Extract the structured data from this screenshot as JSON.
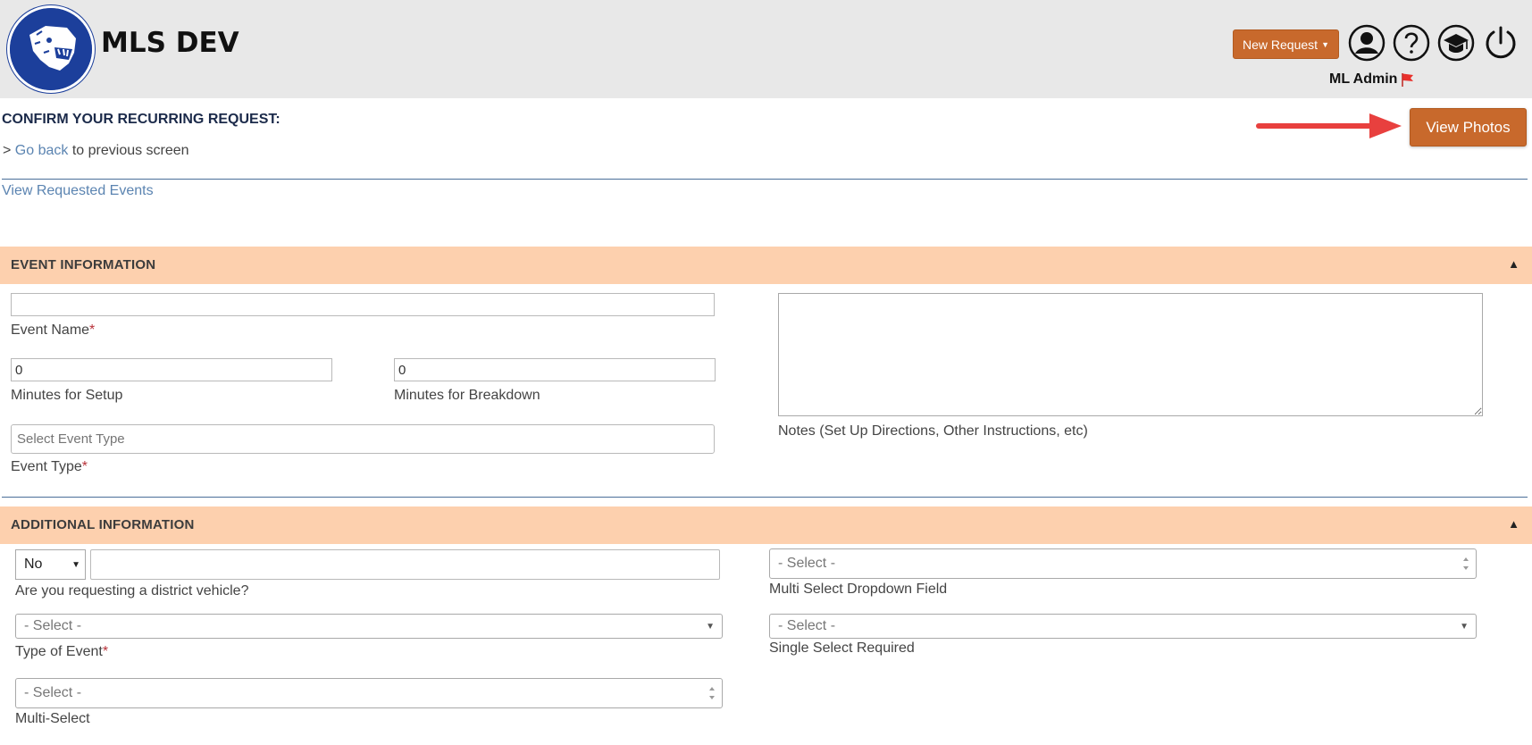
{
  "header": {
    "app_title": "MLS DEV",
    "new_request_label": "New Request",
    "user_name": "ML Admin",
    "logo_icon": "panther-mascot-logo",
    "icons": [
      "user-profile-icon",
      "help-icon",
      "graduation-cap-icon",
      "power-icon"
    ],
    "flag_icon": "red-flag-icon"
  },
  "page": {
    "title": "CONFIRM YOUR RECURRING REQUEST:",
    "go_back_prefix": ">",
    "go_back_link": "Go back",
    "go_back_suffix": "to previous screen",
    "view_requested_events": "View Requested Events",
    "view_photos_label": "View Photos"
  },
  "event_information": {
    "title": "EVENT INFORMATION",
    "event_name": {
      "value": "",
      "label": "Event Name"
    },
    "setup_minutes": {
      "value": "0",
      "label": "Minutes for Setup"
    },
    "breakdown_minutes": {
      "value": "0",
      "label": "Minutes for Breakdown"
    },
    "event_type": {
      "placeholder": "Select Event Type",
      "label": "Event Type"
    },
    "notes": {
      "value": "",
      "label": "Notes (Set Up Directions, Other Instructions, etc)"
    },
    "required_marker": "*"
  },
  "additional_information": {
    "title": "ADDITIONAL INFORMATION",
    "district_vehicle": {
      "selected": "No",
      "text_value": "",
      "label": "Are you requesting a district vehicle?"
    },
    "multi_select_dropdown": {
      "placeholder": "- Select -",
      "label": "Multi Select Dropdown Field"
    },
    "type_of_event": {
      "placeholder": "- Select -",
      "label": "Type of Event"
    },
    "single_select_required": {
      "placeholder": "- Select -",
      "label": "Single Select Required"
    },
    "multi_select": {
      "placeholder": "- Select -",
      "label": "Multi-Select"
    },
    "required_marker": "*"
  },
  "colors": {
    "header_bg": "#e8e8e8",
    "accent_orange": "#c8692c",
    "panel_header_bg": "#fdd0ae",
    "link_blue": "#5b84b1",
    "annotation_arrow": "#e8403e",
    "logo_blue": "#1c3f9b"
  }
}
